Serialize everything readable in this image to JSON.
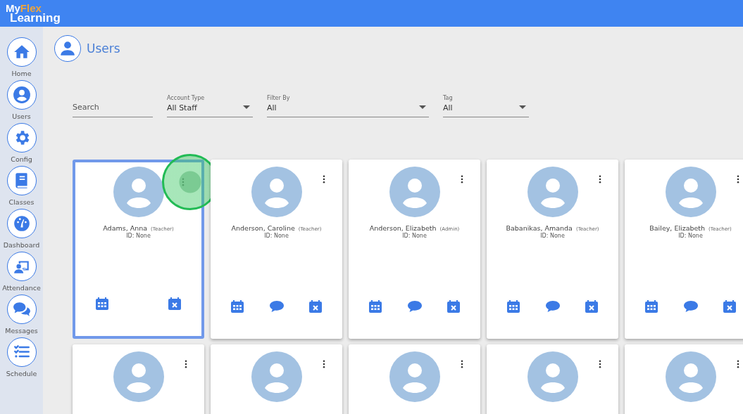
{
  "logo": {
    "first": "My",
    "accent": "Flex",
    "second": "Learning"
  },
  "sidebar": {
    "items": [
      {
        "label": "Home"
      },
      {
        "label": "Users"
      },
      {
        "label": "Config"
      },
      {
        "label": "Classes"
      },
      {
        "label": "Dashboard"
      },
      {
        "label": "Attendance"
      },
      {
        "label": "Messages"
      },
      {
        "label": "Schedule"
      }
    ]
  },
  "page_title": "Users",
  "filters": [
    {
      "kind": "text",
      "placeholder": "Search"
    },
    {
      "kind": "select",
      "label": "Account Type",
      "value": "All Staff"
    },
    {
      "kind": "select",
      "label": "Filter By",
      "value": "All"
    },
    {
      "kind": "select",
      "label": "Tag",
      "value": "All"
    }
  ],
  "cards": [
    {
      "name": "Adams, Anna",
      "role": "(Teacher)",
      "id": "ID: None",
      "selected": true,
      "can_message": false,
      "highlighted_menu": true
    },
    {
      "name": "Anderson, Caroline",
      "role": "(Teacher)",
      "id": "ID: None",
      "selected": false,
      "can_message": true,
      "highlighted_menu": false
    },
    {
      "name": "Anderson, Elizabeth",
      "role": "(Admin)",
      "id": "ID: None",
      "selected": false,
      "can_message": true,
      "highlighted_menu": false
    },
    {
      "name": "Babanikas, Amanda",
      "role": "(Teacher)",
      "id": "ID: None",
      "selected": false,
      "can_message": true,
      "highlighted_menu": false
    },
    {
      "name": "Bailey, Elizabeth",
      "role": "(Teacher)",
      "id": "ID: None",
      "selected": false,
      "can_message": true,
      "highlighted_menu": false
    }
  ],
  "more_cards": [
    {
      "selected": false
    },
    {
      "selected": false
    },
    {
      "selected": false
    },
    {
      "selected": false
    },
    {
      "selected": false
    }
  ]
}
